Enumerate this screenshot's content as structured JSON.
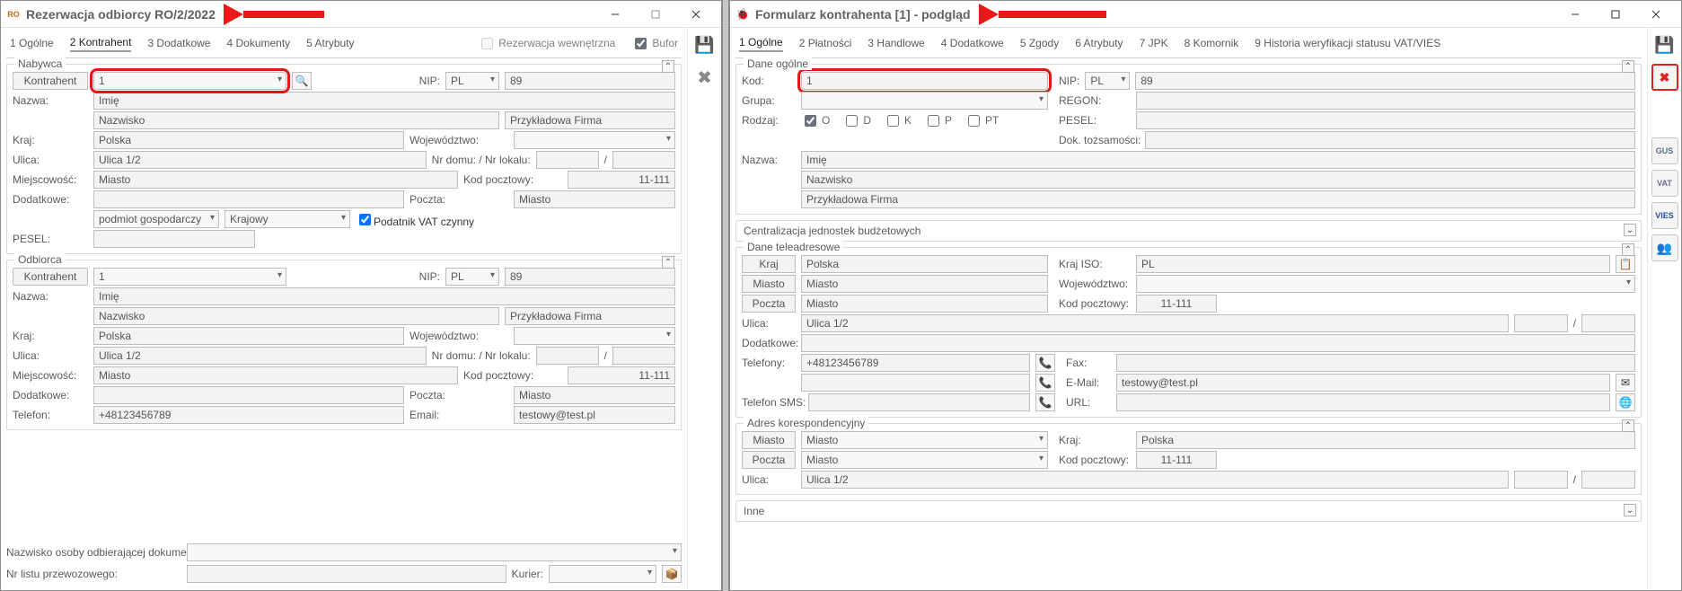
{
  "left": {
    "title": "Rezerwacja odbiorcy RO/2/2022",
    "tabs": {
      "ogolne": "1 Ogólne",
      "kontrahent": "2 Kontrahent",
      "dodatkowe": "3 Dodatkowe",
      "dokumenty": "4 Dokumenty",
      "atrybuty": "5 Atrybuty"
    },
    "chk_wewn": "Rezerwacja wewnętrzna",
    "chk_bufor": "Bufor",
    "nabywca": {
      "legend": "Nabywca",
      "kontrahent_lbl": "Kontrahent",
      "kontrahent_val": "1",
      "nip_lbl": "NIP:",
      "nip_cc": "PL",
      "nip_val": "89",
      "nazwa_lbl": "Nazwa:",
      "imie": "Imię",
      "nazwisko": "Nazwisko",
      "firma": "Przykładowa Firma",
      "kraj_lbl": "Kraj:",
      "kraj": "Polska",
      "woj_lbl": "Województwo:",
      "woj": "",
      "ulica_lbl": "Ulica:",
      "ulica": "Ulica 1/2",
      "nrdomu_lbl": "Nr domu: / Nr lokalu:",
      "nrdomu": "",
      "nrlok": "",
      "miejsc_lbl": "Miejscowość:",
      "miejsc": "Miasto",
      "kodp_lbl": "Kod pocztowy:",
      "kodp": "11-111",
      "dodatk_lbl": "Dodatkowe:",
      "poczta_lbl": "Poczta:",
      "poczta": "Miasto",
      "podmiot": "podmiot gospodarczy",
      "krajowy": "Krajowy",
      "vatczynny": "Podatnik VAT czynny",
      "pesel_lbl": "PESEL:"
    },
    "odbiorca": {
      "legend": "Odbiorca",
      "kontrahent_lbl": "Kontrahent",
      "kontrahent_val": "1",
      "nip_lbl": "NIP:",
      "nip_cc": "PL",
      "nip_val": "89",
      "nazwa_lbl": "Nazwa:",
      "imie": "Imię",
      "nazwisko": "Nazwisko",
      "firma": "Przykładowa Firma",
      "kraj_lbl": "Kraj:",
      "kraj": "Polska",
      "woj_lbl": "Województwo:",
      "woj": "",
      "ulica_lbl": "Ulica:",
      "ulica": "Ulica 1/2",
      "nrdomu_lbl": "Nr domu: / Nr lokalu:",
      "miejsc_lbl": "Miejscowość:",
      "miejsc": "Miasto",
      "kodp_lbl": "Kod pocztowy:",
      "kodp": "11-111",
      "dodatk_lbl": "Dodatkowe:",
      "poczta_lbl": "Poczta:",
      "poczta": "Miasto",
      "telefon_lbl": "Telefon:",
      "telefon": "+48123456789",
      "email_lbl": "Email:",
      "email": "testowy@test.pl"
    },
    "footer": {
      "nazwisko_odb_lbl": "Nazwisko osoby odbierającej dokument:",
      "nrlistu_lbl": "Nr listu przewozowego:",
      "kurier_lbl": "Kurier:"
    },
    "side_save_icon": "💾",
    "side_cancel_icon": "✖"
  },
  "right": {
    "title": "Formularz kontrahenta [1] - podgląd",
    "tabs": {
      "ogolne": "1 Ogólne",
      "platnosci": "2 Płatności",
      "handlowe": "3 Handlowe",
      "dodatkowe": "4 Dodatkowe",
      "zgody": "5 Zgody",
      "atrybuty": "6 Atrybuty",
      "jpk": "7 JPK",
      "komornik": "8 Komornik",
      "historia": "9 Historia weryfikacji statusu VAT/VIES"
    },
    "dane_ogolne": {
      "legend": "Dane ogólne",
      "kod_lbl": "Kod:",
      "kod_val": "1",
      "nip_lbl": "NIP:",
      "nip_cc": "PL",
      "nip_val": "89",
      "grupa_lbl": "Grupa:",
      "regon_lbl": "REGON:",
      "rodzaj_lbl": "Rodzaj:",
      "rodzaj_O": "O",
      "rodzaj_D": "D",
      "rodzaj_K": "K",
      "rodzaj_P": "P",
      "rodzaj_PT": "PT",
      "pesel_lbl": "PESEL:",
      "doktozs_lbl": "Dok. tożsamości:",
      "nazwa_lbl": "Nazwa:",
      "imie": "Imię",
      "nazwisko": "Nazwisko",
      "firma": "Przykładowa Firma"
    },
    "central_lbl": "Centralizacja jednostek budżetowych",
    "dane_tele": {
      "legend": "Dane teleadresowe",
      "kraj_lbl": "Kraj",
      "kraj": "Polska",
      "krajiso_lbl": "Kraj ISO:",
      "krajiso": "PL",
      "miasto_lbl": "Miasto",
      "miasto": "Miasto",
      "woj_lbl": "Województwo:",
      "woj": "",
      "poczta_lbl": "Poczta",
      "poczta": "Miasto",
      "kodp_lbl": "Kod pocztowy:",
      "kodp": "11-111",
      "ulica_lbl": "Ulica:",
      "ulica": "Ulica 1/2",
      "dodatk_lbl": "Dodatkowe:",
      "telefony_lbl": "Telefony:",
      "telefony": "+48123456789",
      "fax_lbl": "Fax:",
      "email_lbl": "E-Mail:",
      "email": "testowy@test.pl",
      "telsms_lbl": "Telefon SMS:",
      "url_lbl": "URL:"
    },
    "adrkor": {
      "legend": "Adres korespondencyjny",
      "miasto_lbl": "Miasto",
      "miasto": "Miasto",
      "kraj_lbl": "Kraj:",
      "kraj": "Polska",
      "poczta_lbl": "Poczta",
      "poczta": "Miasto",
      "kodp_lbl": "Kod pocztowy:",
      "kodp": "11-111",
      "ulica_lbl": "Ulica:",
      "ulica": "Ulica 1/2"
    },
    "inne_lbl": "Inne",
    "side": {
      "save": "💾",
      "cancel": "✖",
      "gus": "GUS",
      "vat": "VAT",
      "vies": "VIES",
      "users": "👥"
    }
  }
}
